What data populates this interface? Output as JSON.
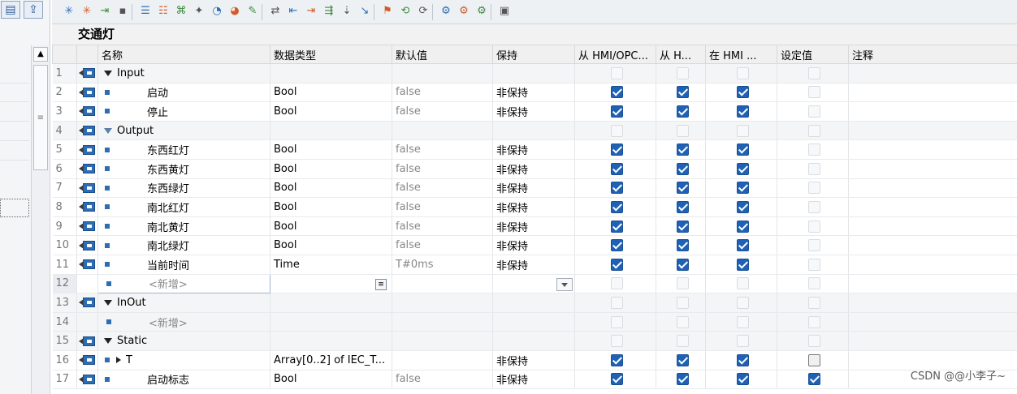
{
  "block_title": "交通灯",
  "columns": [
    "",
    "",
    "名称",
    "数据类型",
    "默认值",
    "保持",
    "从 HMI/OPC...",
    "从 H...",
    "在 HMI ...",
    "设定值",
    "注释"
  ],
  "rows": [
    {
      "num": "1",
      "kind": "group",
      "name": "Input",
      "type": "",
      "default": "",
      "retain": "",
      "hmi1": null,
      "hmi2": null,
      "hmi3": null,
      "setpoint": "off"
    },
    {
      "num": "2",
      "kind": "child",
      "name": "启动",
      "type": "Bool",
      "default": "false",
      "retain": "非保持",
      "hmi1": "on",
      "hmi2": "on",
      "hmi3": "on",
      "setpoint": "off"
    },
    {
      "num": "3",
      "kind": "child",
      "name": "停止",
      "type": "Bool",
      "default": "false",
      "retain": "非保持",
      "hmi1": "on",
      "hmi2": "on",
      "hmi3": "on",
      "setpoint": "off"
    },
    {
      "num": "4",
      "kind": "group",
      "name": "Output",
      "type": "",
      "default": "",
      "retain": "",
      "hmi1": null,
      "hmi2": null,
      "hmi3": null,
      "setpoint": "off"
    },
    {
      "num": "5",
      "kind": "child",
      "name": "东西红灯",
      "type": "Bool",
      "default": "false",
      "retain": "非保持",
      "hmi1": "on",
      "hmi2": "on",
      "hmi3": "on",
      "setpoint": "off"
    },
    {
      "num": "6",
      "kind": "child",
      "name": "东西黄灯",
      "type": "Bool",
      "default": "false",
      "retain": "非保持",
      "hmi1": "on",
      "hmi2": "on",
      "hmi3": "on",
      "setpoint": "off"
    },
    {
      "num": "7",
      "kind": "child",
      "name": "东西绿灯",
      "type": "Bool",
      "default": "false",
      "retain": "非保持",
      "hmi1": "on",
      "hmi2": "on",
      "hmi3": "on",
      "setpoint": "off"
    },
    {
      "num": "8",
      "kind": "child",
      "name": "南北红灯",
      "type": "Bool",
      "default": "false",
      "retain": "非保持",
      "hmi1": "on",
      "hmi2": "on",
      "hmi3": "on",
      "setpoint": "off"
    },
    {
      "num": "9",
      "kind": "child",
      "name": "南北黄灯",
      "type": "Bool",
      "default": "false",
      "retain": "非保持",
      "hmi1": "on",
      "hmi2": "on",
      "hmi3": "on",
      "setpoint": "off"
    },
    {
      "num": "10",
      "kind": "child",
      "name": "南北绿灯",
      "type": "Bool",
      "default": "false",
      "retain": "非保持",
      "hmi1": "on",
      "hmi2": "on",
      "hmi3": "on",
      "setpoint": "off"
    },
    {
      "num": "11",
      "kind": "child",
      "name": "当前时间",
      "type": "Time",
      "default": "T#0ms",
      "retain": "非保持",
      "hmi1": "on",
      "hmi2": "on",
      "hmi3": "on",
      "setpoint": "off"
    },
    {
      "num": "12",
      "kind": "new",
      "name": "<新增>",
      "type": "",
      "default": "",
      "retain": "",
      "hmi1": "off",
      "hmi2": "off",
      "hmi3": "off",
      "setpoint": "off"
    },
    {
      "num": "13",
      "kind": "group",
      "name": "InOut",
      "type": "",
      "default": "",
      "retain": "",
      "hmi1": null,
      "hmi2": null,
      "hmi3": null,
      "setpoint": "off"
    },
    {
      "num": "14",
      "kind": "new2",
      "name": "<新增>",
      "type": "",
      "default": "",
      "retain": "",
      "hmi1": "off",
      "hmi2": "off",
      "hmi3": "off",
      "setpoint": "off"
    },
    {
      "num": "15",
      "kind": "group",
      "name": "Static",
      "type": "",
      "default": "",
      "retain": "",
      "hmi1": null,
      "hmi2": null,
      "hmi3": null,
      "setpoint": "off"
    },
    {
      "num": "16",
      "kind": "struct",
      "name": "T",
      "type": "Array[0..2] of IEC_T...",
      "default": "",
      "retain": "非保持",
      "hmi1": "on",
      "hmi2": "on",
      "hmi3": "on",
      "setpoint": "darkoff"
    },
    {
      "num": "17",
      "kind": "child",
      "name": "启动标志",
      "type": "Bool",
      "default": "false",
      "retain": "非保持",
      "hmi1": "on",
      "hmi2": "on",
      "hmi3": "on",
      "setpoint": "on"
    }
  ],
  "watermark": "CSDN @@小李子~",
  "toolbar_icons": [
    "insert-row-icon",
    "add-row-icon",
    "insert-parameter-icon",
    "move-icon",
    "network-icon",
    "comment-icon",
    "open-icon",
    "close-icon",
    "compile-icon",
    "monitor-icon",
    "set-icon",
    "reset-icon",
    "db-icon"
  ]
}
